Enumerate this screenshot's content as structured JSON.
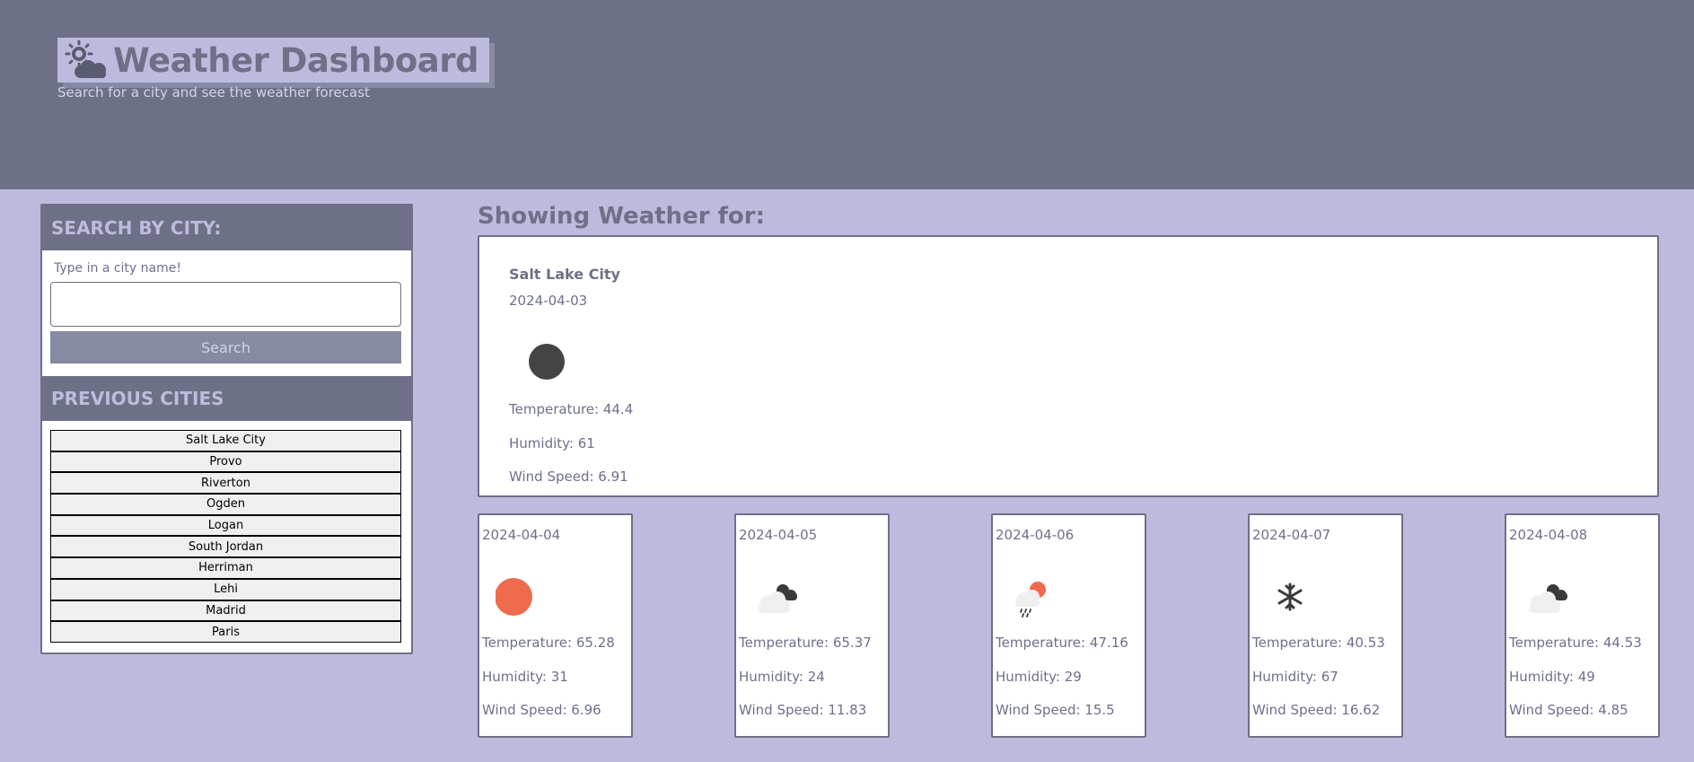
{
  "header": {
    "title": "Weather Dashboard",
    "subtitle": "Search for a city and see the weather forecast",
    "title_icon": "sun-cloud-icon"
  },
  "sidebar": {
    "search_heading": "SEARCH BY CITY:",
    "search_label": "Type in a city name!",
    "search_value": "",
    "search_button": "Search",
    "previous_heading": "PREVIOUS CITIES",
    "cities": [
      "Salt Lake City",
      "Provo",
      "Riverton",
      "Ogden",
      "Logan",
      "South Jordan",
      "Herriman",
      "Lehi",
      "Madrid",
      "Paris"
    ]
  },
  "main": {
    "showing_heading": "Showing Weather for:",
    "current": {
      "city": "Salt Lake City",
      "date": "2024-04-03",
      "icon": "moon-icon",
      "temperature": "Temperature: 44.4",
      "humidity": "Humidity: 61",
      "wind": "Wind Speed: 6.91"
    },
    "forecast": [
      {
        "date": "2024-04-04",
        "icon": "sun-icon",
        "temperature": "Temperature: 65.28",
        "humidity": "Humidity: 31",
        "wind": "Wind Speed: 6.96"
      },
      {
        "date": "2024-04-05",
        "icon": "clouds-icon",
        "temperature": "Temperature: 65.37",
        "humidity": "Humidity: 24",
        "wind": "Wind Speed: 11.83"
      },
      {
        "date": "2024-04-06",
        "icon": "rain-sun-icon",
        "temperature": "Temperature: 47.16",
        "humidity": "Humidity: 29",
        "wind": "Wind Speed: 15.5"
      },
      {
        "date": "2024-04-07",
        "icon": "snowflake-icon",
        "temperature": "Temperature: 40.53",
        "humidity": "Humidity: 67",
        "wind": "Wind Speed: 16.62"
      },
      {
        "date": "2024-04-08",
        "icon": "clouds-icon",
        "temperature": "Temperature: 44.53",
        "humidity": "Humidity: 49",
        "wind": "Wind Speed: 4.85"
      }
    ]
  },
  "colors": {
    "header_bg": "#6e7087",
    "page_bg": "#bdbbdd",
    "button_bg": "#878aa3",
    "sun": "#ee6b4d",
    "moon": "#444444"
  }
}
